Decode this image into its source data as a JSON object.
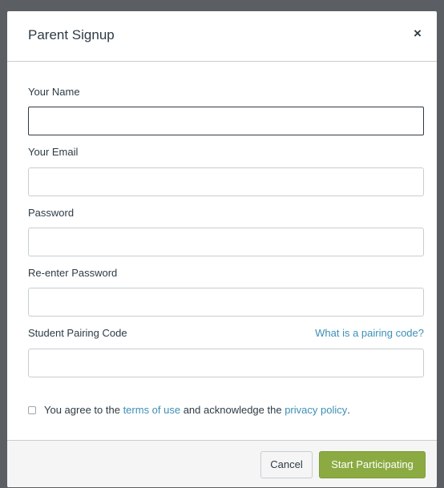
{
  "modal": {
    "title": "Parent Signup",
    "close_label": "×"
  },
  "form": {
    "name_label": "Your Name",
    "name_value": "",
    "email_label": "Your Email",
    "email_value": "",
    "password_label": "Password",
    "password_value": "",
    "reenter_label": "Re-enter Password",
    "reenter_value": "",
    "pairing_label": "Student Pairing Code",
    "pairing_help_link": "What is a pairing code?",
    "pairing_value": ""
  },
  "agreement": {
    "checked": false,
    "prefix": "You agree to the ",
    "terms_link": "terms of use",
    "middle": " and acknowledge the ",
    "privacy_link": "privacy policy",
    "suffix": "."
  },
  "footer": {
    "cancel_label": "Cancel",
    "submit_label": "Start Participating"
  }
}
